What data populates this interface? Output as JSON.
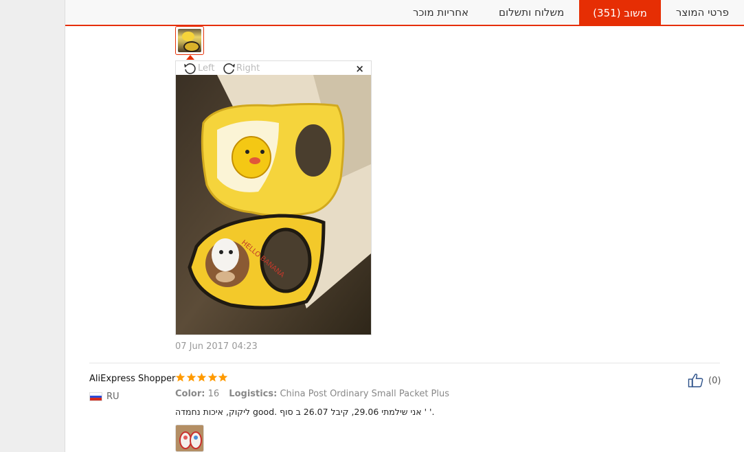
{
  "tabs": [
    {
      "label": "פרטי המוצר",
      "active": false
    },
    {
      "label": "משוב (351)",
      "active": true
    },
    {
      "label": "משלוח ותשלום",
      "active": false
    },
    {
      "label": "אחריות מוכר",
      "active": false
    }
  ],
  "viewer": {
    "rotate_left_label": "Left",
    "rotate_right_label": "Right",
    "close_label": "×"
  },
  "review_date": "07 Jun 2017 04:23",
  "next_review": {
    "buyer": "AliExpress Shopper",
    "country": "RU",
    "rating": 5,
    "color_label": "Color:",
    "color_value": "16",
    "logistics_label": "Logistics:",
    "logistics_value": "China Post Ordinary Small Packet Plus",
    "text": "ליקוק, איכות נחמדה good. אני שילמתי 29.06, קיבל 26.07 ב סוף ' '.",
    "helpful_count": "(0)"
  },
  "colors": {
    "accent": "#e62e04",
    "star": "#ff9a00"
  },
  "icons": {
    "rotate_left": "rotate-left-icon",
    "rotate_right": "rotate-right-icon",
    "close": "close-icon",
    "thumbs_up": "thumbs-up-icon",
    "star": "star-icon",
    "flag": "russia-flag-icon"
  }
}
